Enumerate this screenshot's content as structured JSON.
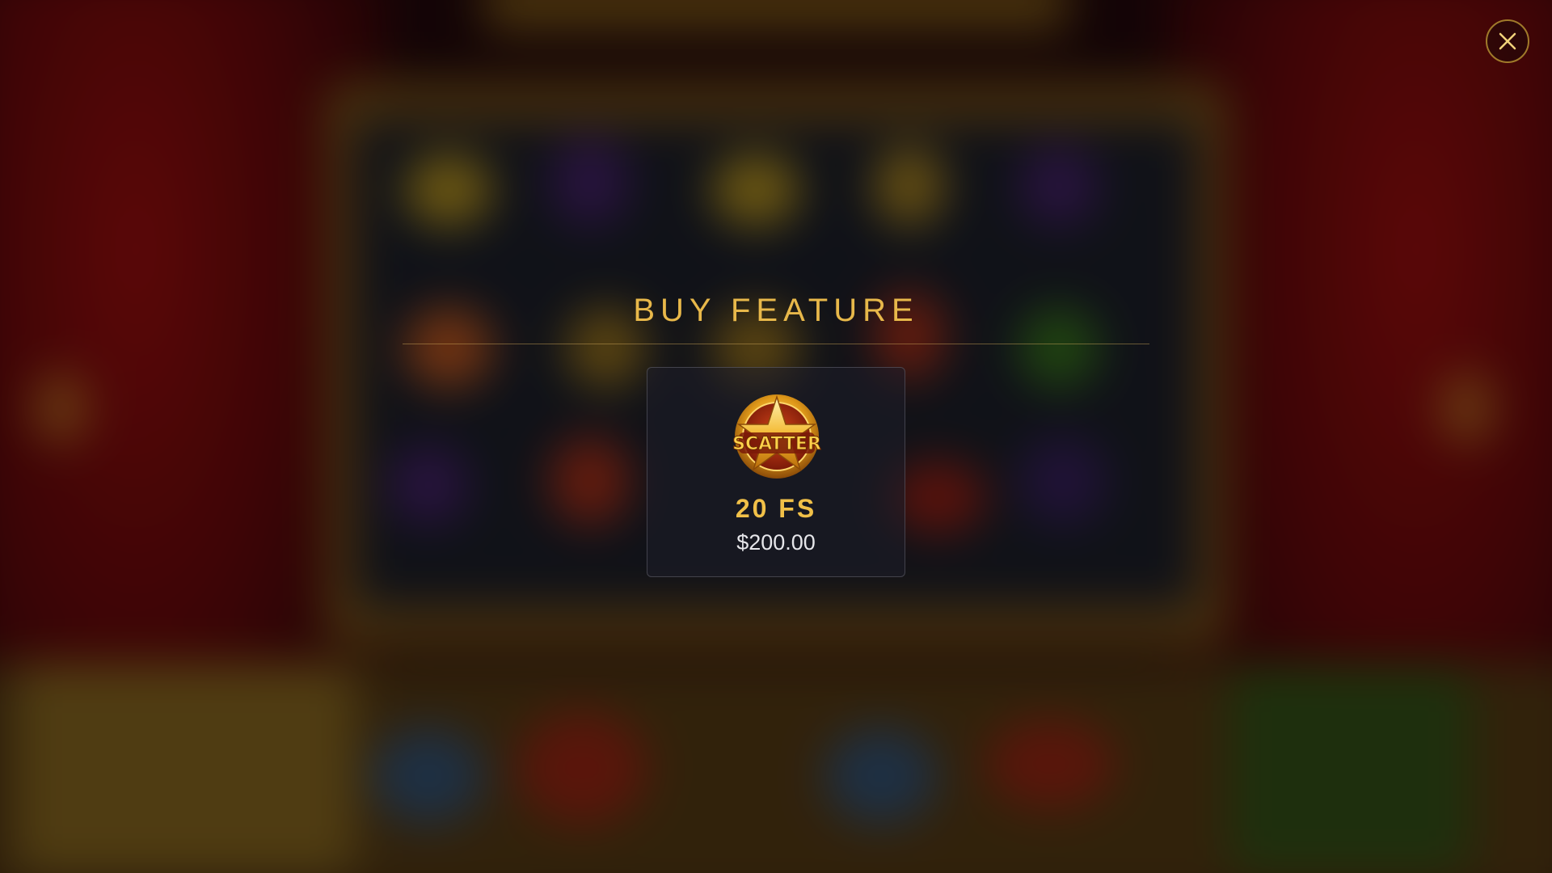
{
  "overlay": {
    "title": "BUY FEATURE",
    "close_icon": "close-icon"
  },
  "features": [
    {
      "icon": "scatter-icon",
      "icon_text": "SCATTER",
      "label": "20 FS",
      "price": "$200.00"
    }
  ],
  "colors": {
    "accent_gold": "#e8b84a",
    "label_gold": "#f1c048",
    "price_text": "#e6e6ea",
    "close_border": "#a07a2a"
  }
}
